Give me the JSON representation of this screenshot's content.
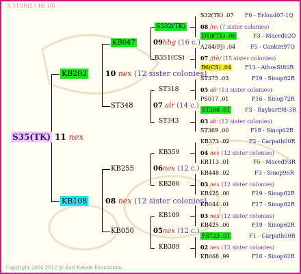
{
  "header": {
    "date": "3. 11-2012 ( 16: 10)"
  },
  "footer": {
    "copyright": "Copyright 2004-2012 @ Karl Kehrle Foundation."
  },
  "root": {
    "name": "S35(TK)",
    "gen": "11",
    "mark": "nex"
  },
  "gen1": [
    {
      "name": "KB202",
      "gen": "10",
      "mark": "nex",
      "note": "(12 sister colonies)"
    },
    {
      "name": "KB108",
      "gen": "08",
      "mark": "nex",
      "note": "(12 sister colonies)"
    }
  ],
  "gen2": [
    {
      "name": "KB047",
      "gen": "09",
      "mark": "hbg",
      "note": "(16 c.)"
    },
    {
      "name": "ST348",
      "gen": "07",
      "mark": "alr",
      "note": "(14 c.)"
    },
    {
      "name": "KB255",
      "gen": "06",
      "mark": "nex",
      "note": "(12 c.)"
    },
    {
      "name": "KB050",
      "gen": "05",
      "mark": "nex",
      "note": "(12 c.)"
    }
  ],
  "gen3": [
    "S532(TK)",
    "B351(CS)",
    "ST318",
    "ST343",
    "KB359",
    "KB266",
    "KB109",
    "KB309"
  ],
  "gen4": [
    {
      "top": "S32(TK) .07",
      "top_code": "F0 - Erfoud07-1Q",
      "mid": "08",
      "mid_mark": "/ns",
      "mid_note": "(7 sister colonies)",
      "bot": "D18(TK) .06",
      "bot_code": "F3 - Maced02Q"
    },
    {
      "top": "A284(PJ) .04",
      "top_code": "F5 - Cankiri97Q",
      "mid": "07",
      "mid_mark": "/fth/",
      "mid_note": "(15 sister colonies)",
      "bot": "B6(CS) .04",
      "bot_code": "F13 - AthosSt80R"
    },
    {
      "top": "ST375 .03",
      "top_code": "F19 - Sinop62R",
      "mid": "05",
      "mid_mark": "alr",
      "mid_note": "(13 sister colonies)",
      "bot": "PS017 .01",
      "bot_code": "F16 - Sinop72R"
    },
    {
      "top": "ST308 .01",
      "top_code": "F3 - Bayburt98-3R",
      "mid": "03",
      "mid_mark": "alr",
      "mid_note": "(12 sister colonies)",
      "bot": "ST369 .00",
      "bot_code": "F18 - Sinop62R"
    },
    {
      "top": "KB373 .02",
      "top_code": "F2 - Carpath00R",
      "mid": "04",
      "mid_mark": "nex",
      "mid_note": "(12 sister colonies)",
      "bot": "KB113 .01",
      "bot_code": "F5 - Maced93R"
    },
    {
      "top": "KB448 .02",
      "top_code": "F3 - Sinop96R",
      "mid": "03",
      "mid_mark": "nex",
      "mid_note": "(12 sister colonies)",
      "bot": "KB425 .00",
      "bot_code": "F19 - Sinop62R"
    },
    {
      "top": "KB044 .01",
      "top_code": "F17 - Sinop62R",
      "mid": "03",
      "mid_mark": "nex",
      "mid_note": "(12 sister colonies)",
      "bot": "KB425 .00",
      "bot_code": "F19 - Sinop62R"
    },
    {
      "top": "PS723 .01",
      "top_code": "F1 - Carpath00R",
      "mid": "02",
      "mid_mark": "nex",
      "mid_note": "(12 sister colonies)",
      "bot": "KB068 .99",
      "bot_code": "F16 - Sinop62R"
    }
  ]
}
